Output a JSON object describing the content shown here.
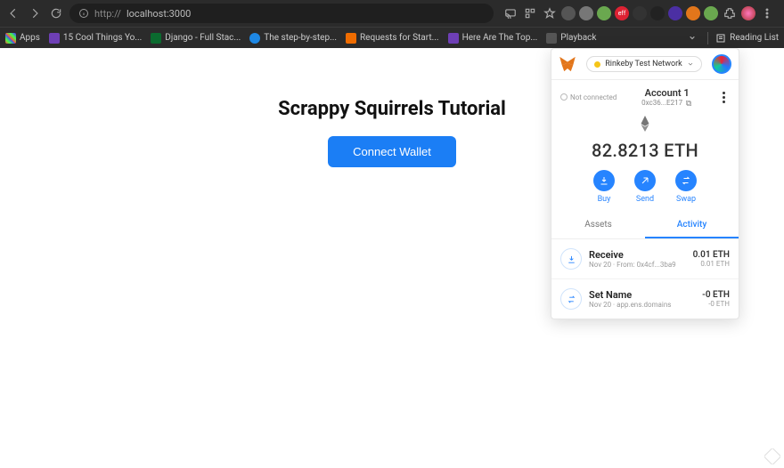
{
  "browser": {
    "url_display": "localhost:3000",
    "url_prefix": "http://",
    "bookmarks": [
      {
        "label": "Apps",
        "color": "#4caf50"
      },
      {
        "label": "15 Cool Things Yo...",
        "color": "#6e3fb5"
      },
      {
        "label": "Django - Full Stac...",
        "color": "#0b6b2f"
      },
      {
        "label": "The step-by-step...",
        "color": "#1e88e5"
      },
      {
        "label": "Requests for Start...",
        "color": "#ef6c00"
      },
      {
        "label": "Here Are The Top...",
        "color": "#6e3fb5"
      },
      {
        "label": "Playback",
        "color": "#555"
      }
    ],
    "reading_list": "Reading List"
  },
  "page": {
    "title": "Scrappy Squirrels Tutorial",
    "cta": "Connect Wallet"
  },
  "mm": {
    "network": "Rinkeby Test Network",
    "not_connected": "Not connected",
    "account_name": "Account 1",
    "account_short": "0xc36...E217",
    "balance": "82.8213 ETH",
    "actions": {
      "buy": "Buy",
      "send": "Send",
      "swap": "Swap"
    },
    "tabs": {
      "assets": "Assets",
      "activity": "Activity"
    },
    "tx": [
      {
        "title": "Receive",
        "sub": "Nov 20 · From: 0x4cf...3ba9",
        "amt": "0.01 ETH",
        "amt2": "0.01 ETH",
        "icon": "download"
      },
      {
        "title": "Set Name",
        "sub": "Nov 20 · app.ens.domains",
        "amt": "-0 ETH",
        "amt2": "-0 ETH",
        "icon": "swap"
      }
    ]
  }
}
